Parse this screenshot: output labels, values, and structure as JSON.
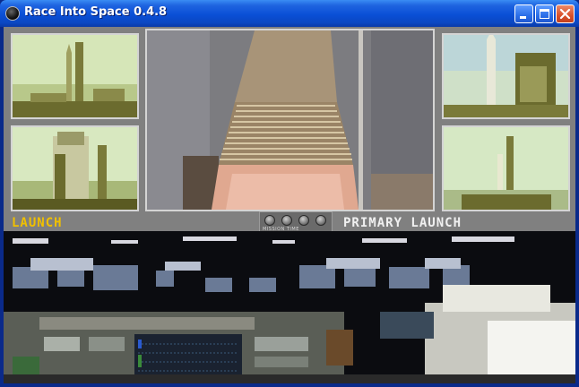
{
  "window": {
    "title": "Race Into Space 0.4.8",
    "controls": [
      "minimize",
      "maximize",
      "close"
    ]
  },
  "launch_screen": {
    "left_label": "LAUNCH",
    "right_label": "PRIMARY LAUNCH",
    "strip_text": "MISSION TIME",
    "label_colors": {
      "left": "#f0c000",
      "right": "#f0f0f0"
    }
  }
}
